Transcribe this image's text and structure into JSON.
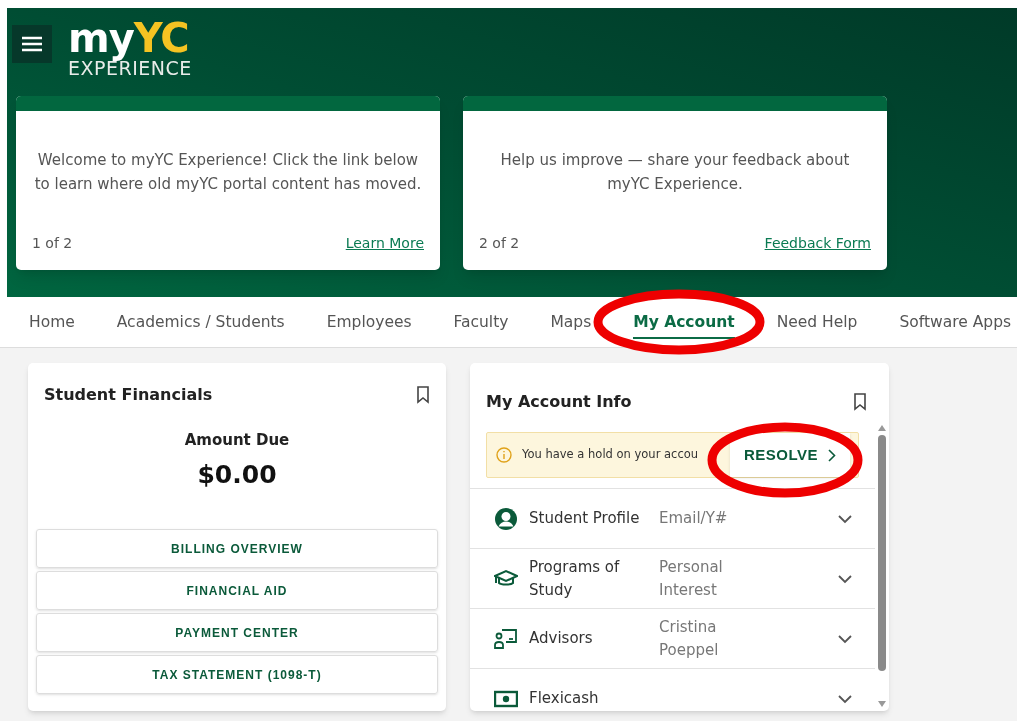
{
  "header": {
    "logo": {
      "plain": "my",
      "accent": "YC",
      "tagline": "EXPERIENCE"
    }
  },
  "announcements": [
    {
      "message": "Welcome to myYC Experience! Click the link below to learn where old myYC portal content has moved.",
      "counter": "1 of 2",
      "link": "Learn More"
    },
    {
      "message": "Help us improve — share your feedback about myYC Experience.",
      "counter": "2 of 2",
      "link": "Feedback Form"
    }
  ],
  "nav_tabs": [
    {
      "label": "Home",
      "selected": false
    },
    {
      "label": "Academics / Students",
      "selected": false
    },
    {
      "label": "Employees",
      "selected": false
    },
    {
      "label": "Faculty",
      "selected": false
    },
    {
      "label": "Maps",
      "selected": false
    },
    {
      "label": "My Account",
      "selected": true
    },
    {
      "label": "Need Help",
      "selected": false
    },
    {
      "label": "Software Apps",
      "selected": false
    }
  ],
  "financials": {
    "title": "Student Financials",
    "amount_label": "Amount Due",
    "amount": "$0.00",
    "buttons": [
      "BILLING OVERVIEW",
      "FINANCIAL AID",
      "PAYMENT CENTER",
      "TAX STATEMENT (1098-T)"
    ]
  },
  "account_info": {
    "title": "My Account Info",
    "hold": {
      "message": "You have a hold on your accou",
      "action": "RESOLVE"
    },
    "rows": [
      {
        "kind": "profile",
        "label": "Student Profile",
        "value": "Email/Y#"
      },
      {
        "kind": "programs",
        "label": "Programs of Study",
        "value": "Personal Interest"
      },
      {
        "kind": "advisors",
        "label": "Advisors",
        "value": "Cristina Poeppel"
      },
      {
        "kind": "money",
        "label": "Flexicash"
      }
    ]
  }
}
